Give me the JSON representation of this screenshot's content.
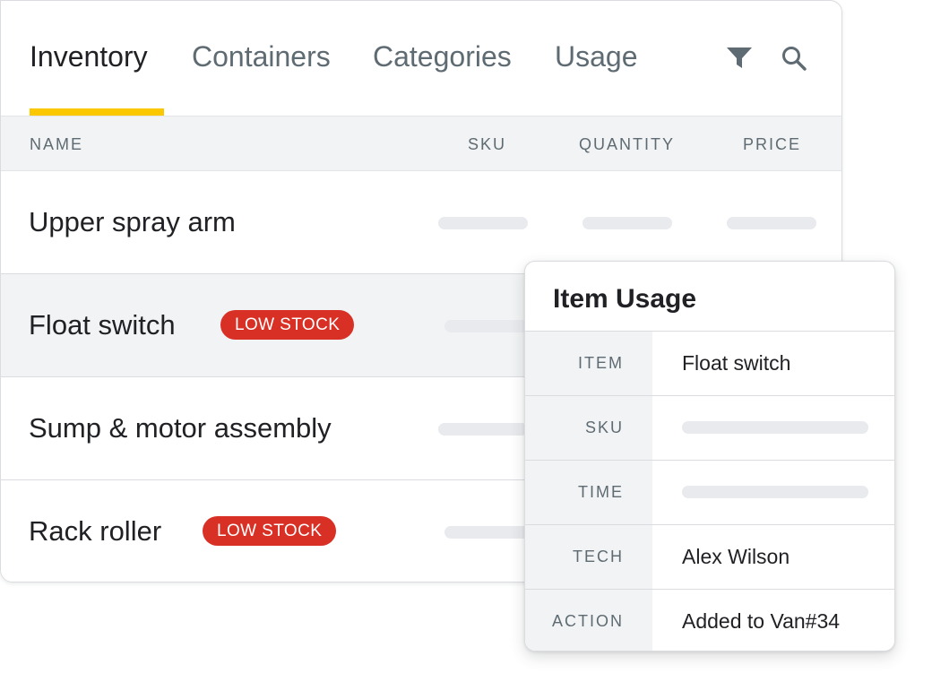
{
  "tabs": [
    {
      "label": "Inventory",
      "active": true
    },
    {
      "label": "Containers",
      "active": false
    },
    {
      "label": "Categories",
      "active": false
    },
    {
      "label": "Usage",
      "active": false
    }
  ],
  "toolbar": {
    "filter_icon": "filter-icon",
    "search_icon": "search-icon"
  },
  "table": {
    "columns": [
      "NAME",
      "SKU",
      "QUANTITY",
      "PRICE"
    ],
    "rows": [
      {
        "name": "Upper spray arm",
        "badge": ""
      },
      {
        "name": "Float switch",
        "badge": "LOW STOCK",
        "highlighted": true
      },
      {
        "name": "Sump & motor assembly",
        "badge": ""
      },
      {
        "name": "Rack roller",
        "badge": "LOW STOCK"
      }
    ]
  },
  "usage_popup": {
    "title": "Item Usage",
    "fields": [
      {
        "label": "ITEM",
        "value": "Float switch"
      },
      {
        "label": "SKU",
        "value": ""
      },
      {
        "label": "TIME",
        "value": ""
      },
      {
        "label": "TECH",
        "value": "Alex Wilson"
      },
      {
        "label": "ACTION",
        "value": "Added to Van#34"
      }
    ]
  },
  "colors": {
    "accent": "#fbc800",
    "badge": "#d93025",
    "header_bg": "#f1f3f4",
    "placeholder": "#e8eaed"
  }
}
